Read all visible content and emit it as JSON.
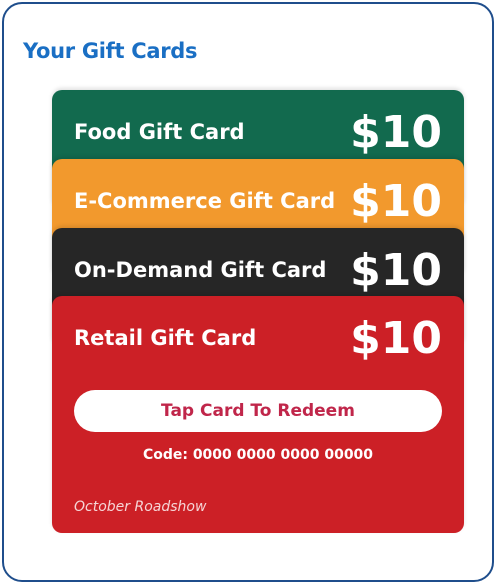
{
  "header": {
    "title": "Your Gift Cards"
  },
  "cards": [
    {
      "name": "Food Gift Card",
      "amount": "$10",
      "color": "#126a4e"
    },
    {
      "name": "E-Commerce Gift Card",
      "amount": "$10",
      "color": "#f2992d"
    },
    {
      "name": "On-Demand Gift Card",
      "amount": "$10",
      "color": "#262626"
    },
    {
      "name": "Retail Gift Card",
      "amount": "$10",
      "color": "#cc2026",
      "redeem_label": "Tap Card To Redeem",
      "code": "Code: 0000 0000 0000 00000",
      "event": "October Roadshow"
    }
  ]
}
